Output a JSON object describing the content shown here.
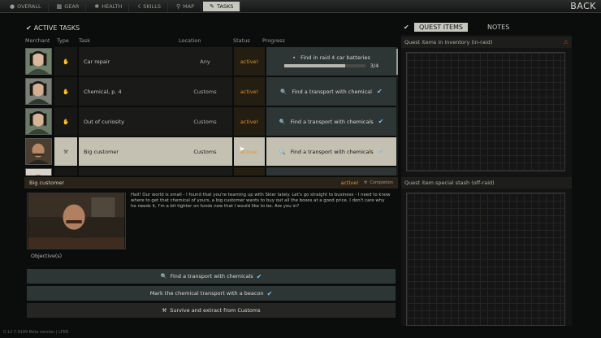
{
  "nav": {
    "tabs": [
      {
        "label": "OVERALL",
        "icon": "person-icon"
      },
      {
        "label": "GEAR",
        "icon": "gear-icon"
      },
      {
        "label": "HEALTH",
        "icon": "health-icon"
      },
      {
        "label": "SKILLS",
        "icon": "skills-icon"
      },
      {
        "label": "MAP",
        "icon": "map-pin-icon"
      },
      {
        "label": "TASKS",
        "icon": "tasks-icon"
      }
    ],
    "active_tab": "TASKS",
    "back_label": "BACK"
  },
  "tasks_panel": {
    "title": "ACTIVE TASKS",
    "columns": {
      "merchant": "Merchant",
      "type": "Type",
      "task": "Task",
      "location": "Location",
      "status": "Status",
      "progress": "Progress"
    },
    "rows": [
      {
        "task": "Car repair",
        "location": "Any",
        "status": "active!",
        "progress_text": "Find in raid 4 car batteries",
        "progress_count": "3/4",
        "progress_fraction": 0.75
      },
      {
        "task": "Chemical, p. 4",
        "location": "Customs",
        "status": "active!",
        "progress_text": "Find a transport with chemical"
      },
      {
        "task": "Out of curiosity",
        "location": "Customs",
        "status": "active!",
        "progress_text": "Find a transport with chemicals"
      },
      {
        "task": "Big customer",
        "location": "Customs",
        "status": "active!",
        "progress_text": "Find a transport with chemicals",
        "selected": true
      }
    ]
  },
  "detail": {
    "title": "Big customer",
    "status": "active!",
    "completion_label": "Completion",
    "description": "Hail! Our world is small - I found that you're teaming up with Skier lately. Let's go straight to business - I need to know where to get that chemical of yours, a big customer wants to buy out all the boxes at a good price. I don't care why he needs it, I'm a bit tighter on funds now that I would like to be. Are you in?",
    "objectives_label": "Objective(s)",
    "objectives": [
      {
        "text": "Find a transport with chemicals",
        "done": true
      },
      {
        "text": "Mark the chemical transport with a beacon",
        "done": true
      },
      {
        "text": "Survive and extract from Customs",
        "done": false
      }
    ]
  },
  "quest_panel": {
    "tab_quest_items": "QUEST ITEMS",
    "tab_notes": "NOTES",
    "inventory_header": "Quest items in inventory (in-raid)",
    "stash_header": "Quest item special stash (off-raid)"
  },
  "footer": "0.12.7.9189 Beta version | LFKR",
  "colors": {
    "accent": "#e0962a",
    "check": "#7fc0e6",
    "warning": "#c83a2e"
  }
}
